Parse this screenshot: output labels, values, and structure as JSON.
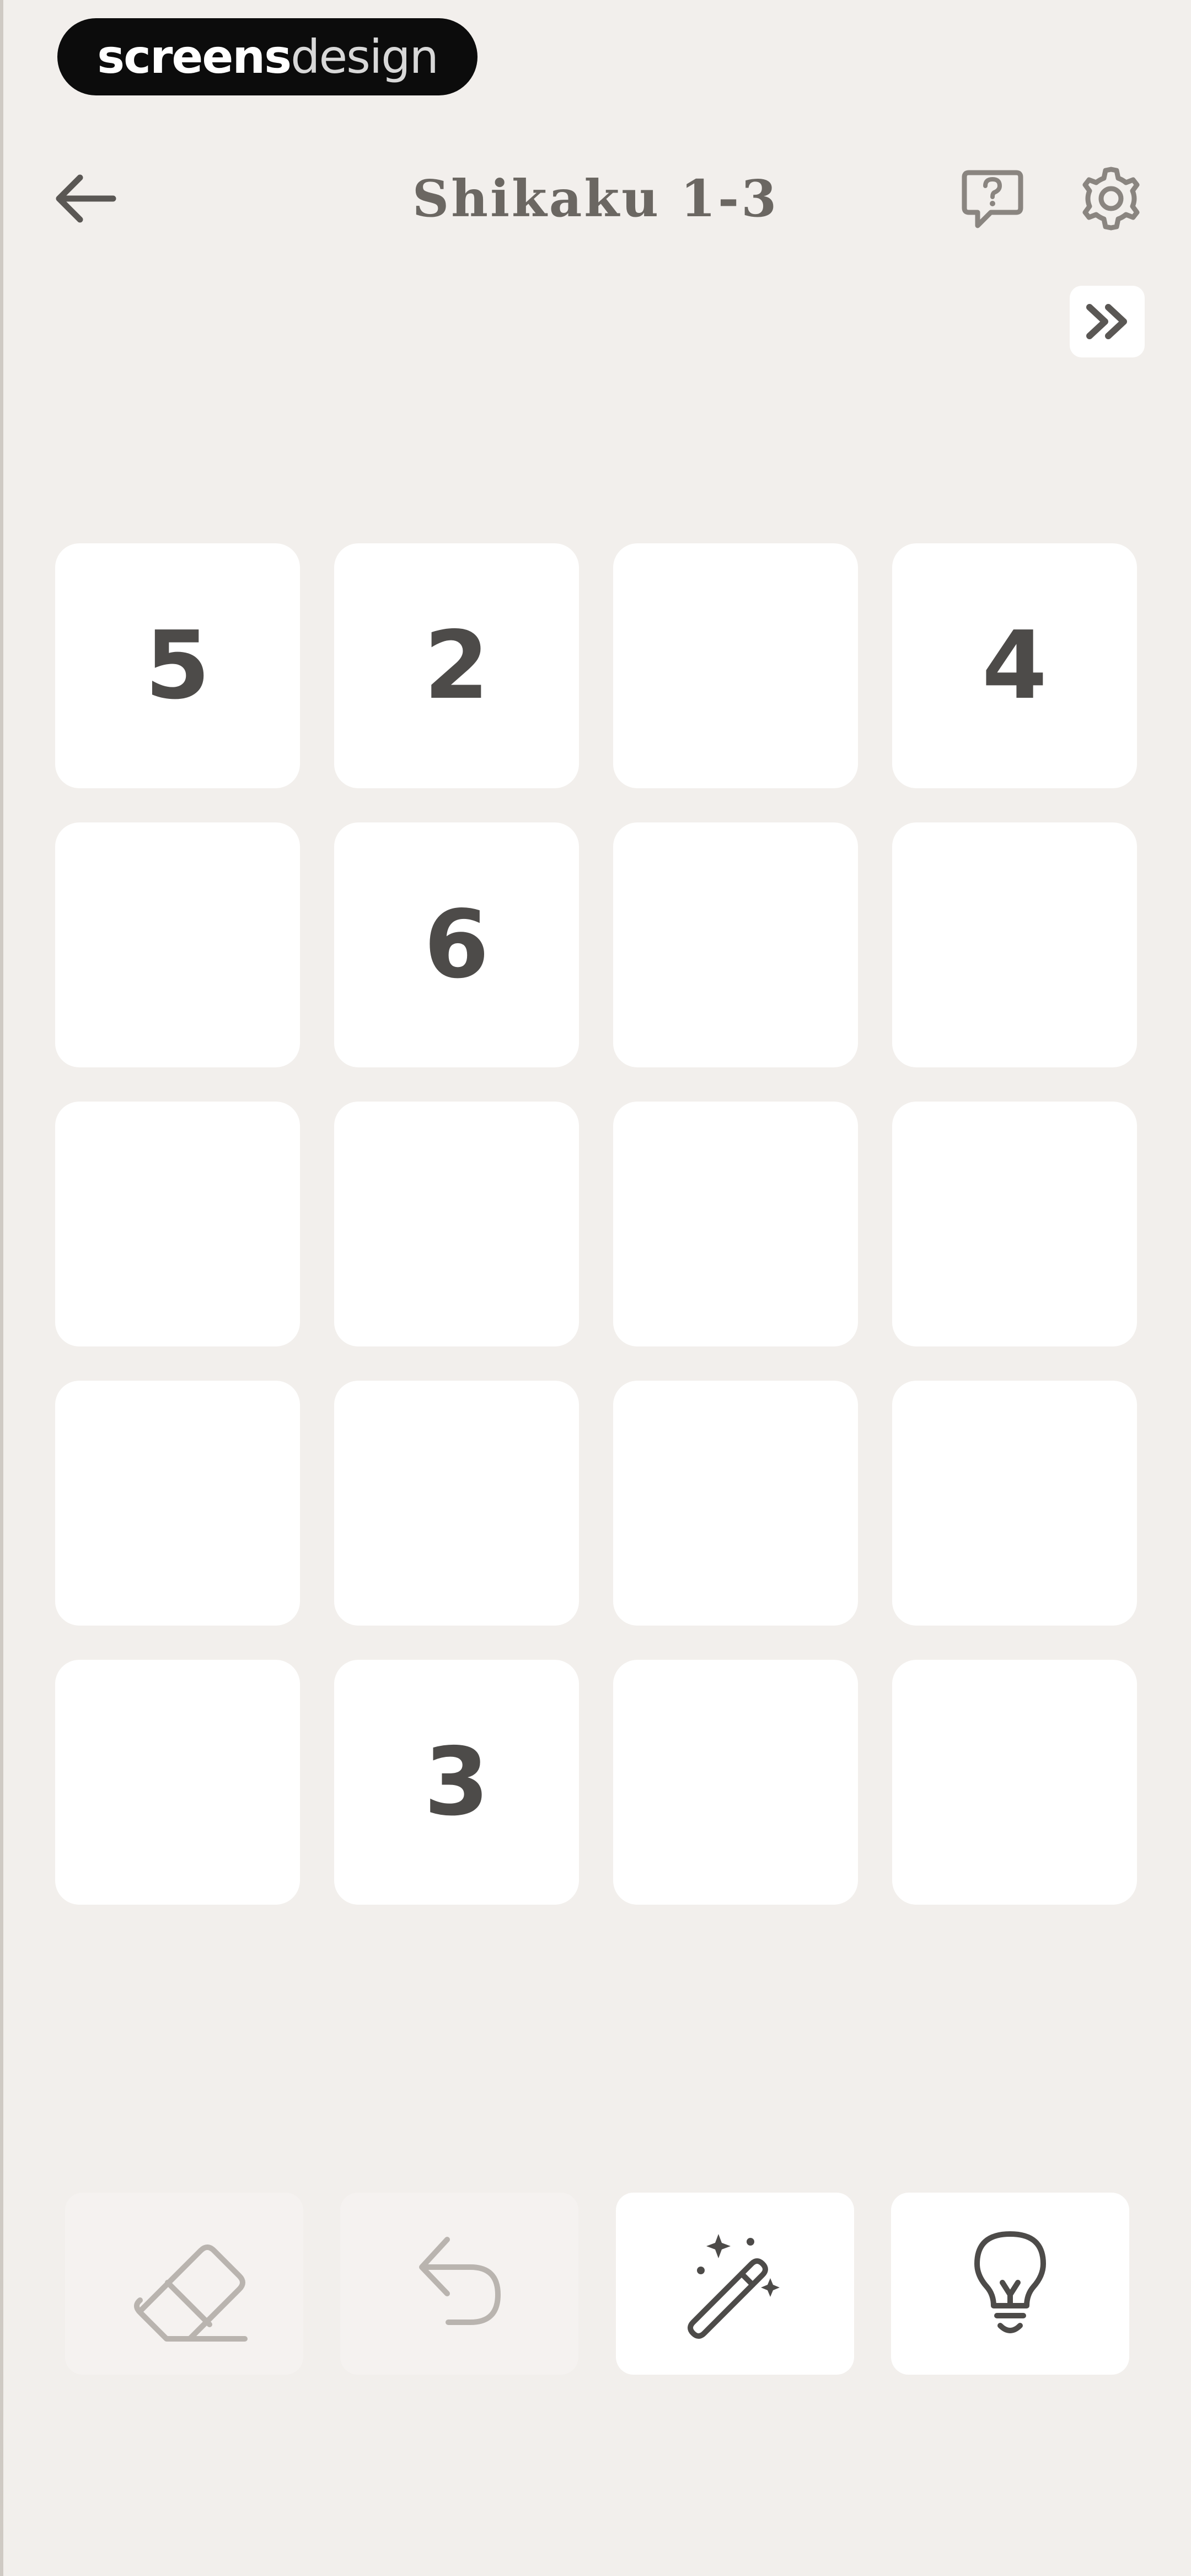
{
  "watermark": {
    "part1": "screens",
    "part2": "design"
  },
  "header": {
    "title": "Shikaku 1-3",
    "back_icon": "arrow-left-icon",
    "help_icon": "question-bubble-icon",
    "settings_icon": "gear-icon",
    "skip_icon": "double-chevron-right-icon"
  },
  "grid": {
    "columns": 4,
    "rows": 5,
    "cells": [
      [
        "5",
        "2",
        "",
        "4"
      ],
      [
        "",
        "6",
        "",
        ""
      ],
      [
        "",
        "",
        "",
        ""
      ],
      [
        "",
        "",
        "",
        ""
      ],
      [
        "",
        "3",
        "",
        ""
      ]
    ]
  },
  "toolbar": {
    "tools": [
      {
        "icon": "eraser-icon",
        "enabled": false
      },
      {
        "icon": "undo-icon",
        "enabled": false
      },
      {
        "icon": "magic-wand-icon",
        "enabled": true
      },
      {
        "icon": "lightbulb-icon",
        "enabled": true
      }
    ]
  },
  "colors": {
    "background": "#f2efec",
    "cell": "#ffffff",
    "number": "#4d4b49",
    "title": "#6b6762",
    "icon": "#5a5754",
    "icon_disabled": "#b9b4af"
  }
}
